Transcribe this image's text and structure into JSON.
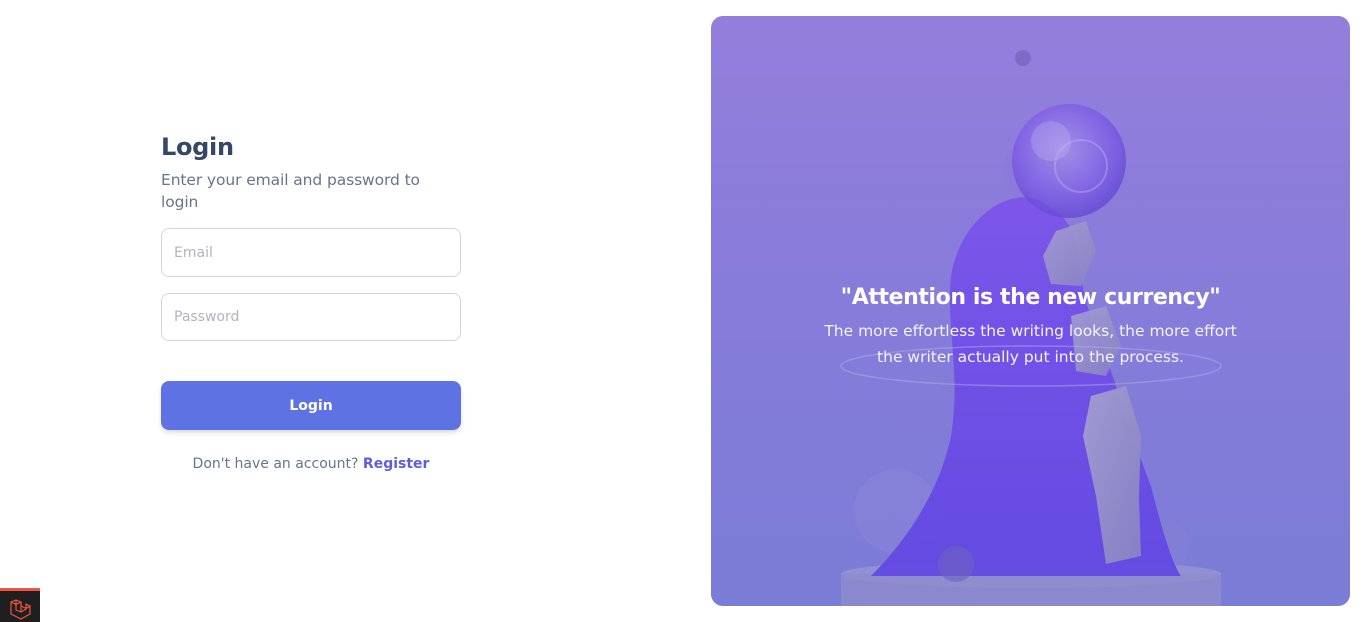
{
  "login": {
    "title": "Login",
    "subtitle": "Enter your email and password to login",
    "email_placeholder": "Email",
    "password_placeholder": "Password",
    "submit_label": "Login",
    "no_account_text": "Don't have an account?",
    "register_label": "Register"
  },
  "hero": {
    "quote": "\"Attention is the new currency\"",
    "body": "The more effortless the writing looks, the more effort the writer actually put into the process."
  },
  "debug_badge": {
    "icon": "laravel-logo-icon"
  },
  "colors": {
    "primary": "#5e72e4",
    "heading": "#344767",
    "muted": "#67748e",
    "link": "#5e5ce6",
    "hero_tint": "#8e83d9"
  }
}
